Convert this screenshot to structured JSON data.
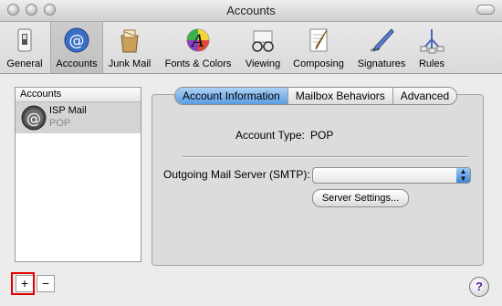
{
  "window": {
    "title": "Accounts"
  },
  "toolbar": {
    "items": [
      {
        "label": "General",
        "icon": "switch-icon"
      },
      {
        "label": "Accounts",
        "icon": "at-icon",
        "selected": true
      },
      {
        "label": "Junk Mail",
        "icon": "junk-mail-icon"
      },
      {
        "label": "Fonts & Colors",
        "icon": "fonts-colors-icon"
      },
      {
        "label": "Viewing",
        "icon": "glasses-icon"
      },
      {
        "label": "Composing",
        "icon": "pen-paper-icon"
      },
      {
        "label": "Signatures",
        "icon": "signature-pen-icon"
      },
      {
        "label": "Rules",
        "icon": "rules-icon"
      }
    ]
  },
  "accounts": {
    "header": "Accounts",
    "list": [
      {
        "name": "ISP Mail",
        "type": "POP"
      }
    ]
  },
  "tabs": [
    {
      "label": "Account Information",
      "selected": true
    },
    {
      "label": "Mailbox Behaviors"
    },
    {
      "label": "Advanced"
    }
  ],
  "account_info": {
    "type_label": "Account Type:",
    "type_value": "POP",
    "smtp_label": "Outgoing Mail Server (SMTP):",
    "smtp_value": "",
    "server_settings": "Server Settings..."
  },
  "footer": {
    "add": "+",
    "remove": "−",
    "help": "?"
  },
  "colors": {
    "selection_blue": "#5a9de3",
    "highlight_red": "#e00000"
  }
}
